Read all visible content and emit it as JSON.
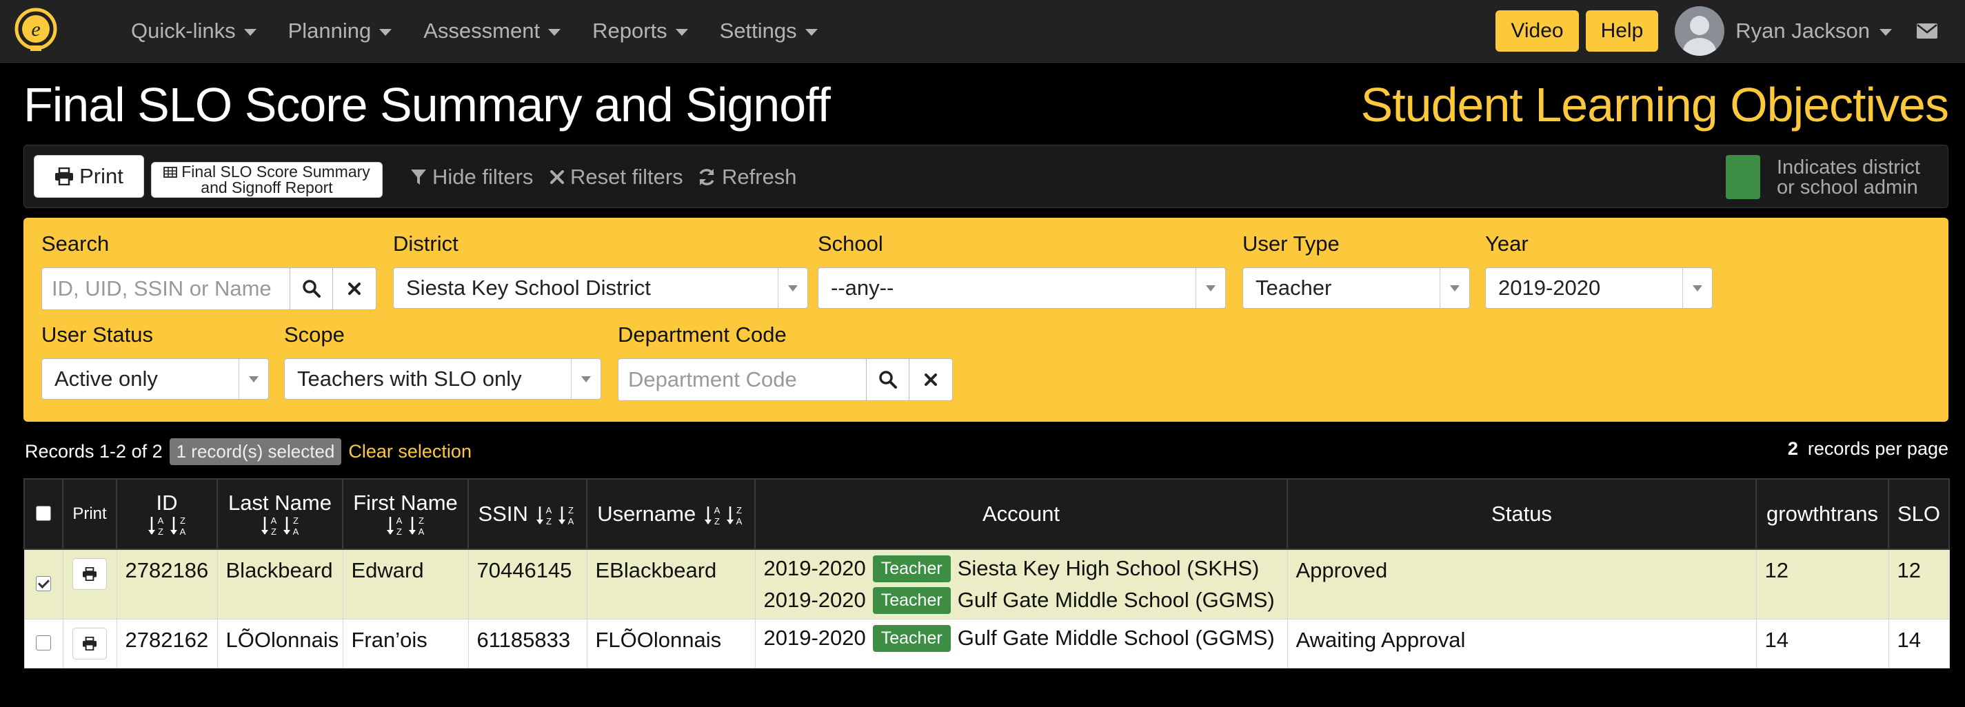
{
  "nav": {
    "menu": [
      "Quick-links",
      "Planning",
      "Assessment",
      "Reports",
      "Settings"
    ],
    "video_label": "Video",
    "help_label": "Help",
    "user_name": "Ryan Jackson"
  },
  "page": {
    "title": "Final SLO Score Summary and Signoff",
    "subtitle": "Student Learning Objectives"
  },
  "toolbar": {
    "print_label": "Print",
    "report_label_1": "Final SLO Score Summary",
    "report_label_2": "and Signoff Report",
    "hide_filters": "Hide filters",
    "reset_filters": "Reset filters",
    "refresh": "Refresh",
    "legend_line1": "Indicates district",
    "legend_line2": "or school admin",
    "legend_color": "#3e8d45"
  },
  "filters": {
    "search_label": "Search",
    "search_placeholder": "ID, UID, SSIN or Name",
    "district_label": "District",
    "district_value": "Siesta Key School District",
    "school_label": "School",
    "school_value": "--any--",
    "user_type_label": "User Type",
    "user_type_value": "Teacher",
    "year_label": "Year",
    "year_value": "2019-2020",
    "user_status_label": "User Status",
    "user_status_value": "Active only",
    "scope_label": "Scope",
    "scope_value": "Teachers with SLO only",
    "dept_label": "Department Code",
    "dept_placeholder": "Department Code"
  },
  "records": {
    "range": "Records 1-2 of 2",
    "selected": "1 record(s) selected",
    "clear": "Clear selection",
    "per_page_count": "2",
    "per_page_label": "records per page"
  },
  "table": {
    "headers": {
      "print": "Print",
      "id": "ID",
      "last_name": "Last Name",
      "first_name": "First Name",
      "ssin": "SSIN",
      "username": "Username",
      "account": "Account",
      "status": "Status",
      "growthtrans": "growthtrans",
      "slo": "SLO"
    },
    "rows": [
      {
        "checked": true,
        "id": "2782186",
        "last_name": "Blackbeard",
        "first_name": "Edward",
        "ssin": "70446145",
        "username": "EBlackbeard",
        "accounts": [
          {
            "year": "2019-2020",
            "role": "Teacher",
            "school": "Siesta Key High School (SKHS)"
          },
          {
            "year": "2019-2020",
            "role": "Teacher",
            "school": "Gulf Gate Middle School (GGMS)"
          }
        ],
        "status": "Approved",
        "growthtrans": "12",
        "slo": "12"
      },
      {
        "checked": false,
        "id": "2782162",
        "last_name": "LÕOlonnais",
        "first_name": "Fran’ois",
        "ssin": "61185833",
        "username": "FLÕOlonnais",
        "accounts": [
          {
            "year": "2019-2020",
            "role": "Teacher",
            "school": "Gulf Gate Middle School (GGMS)"
          }
        ],
        "status": "Awaiting Approval",
        "growthtrans": "14",
        "slo": "14"
      }
    ]
  }
}
